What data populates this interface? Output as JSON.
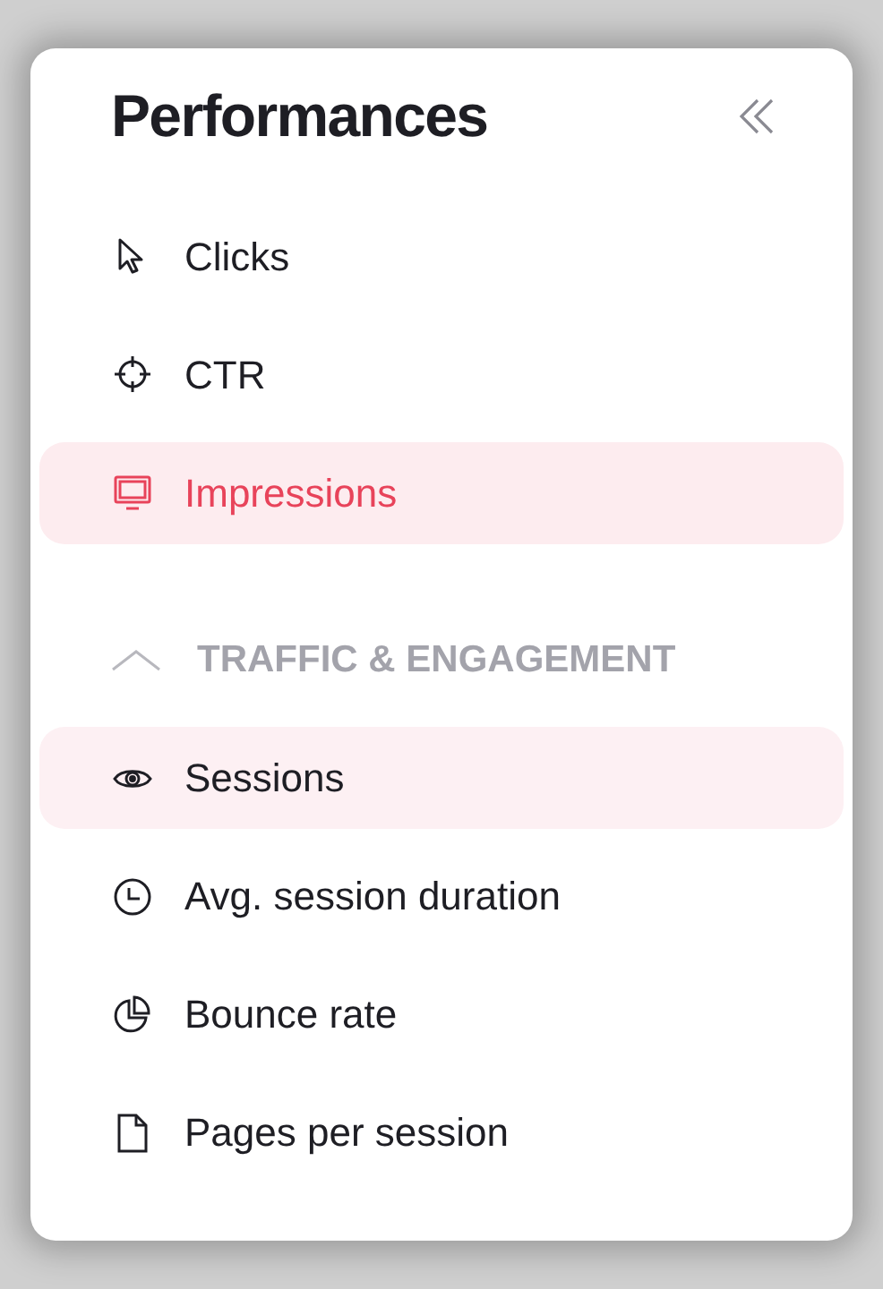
{
  "title": "Performances",
  "items": [
    {
      "label": "Clicks",
      "selected": false,
      "hovered": false
    },
    {
      "label": "CTR",
      "selected": false,
      "hovered": false
    },
    {
      "label": "Impressions",
      "selected": true,
      "hovered": false
    }
  ],
  "section": {
    "label": "TRAFFIC & ENGAGEMENT",
    "expanded": true,
    "items": [
      {
        "label": "Sessions",
        "selected": false,
        "hovered": true
      },
      {
        "label": "Avg. session duration",
        "selected": false,
        "hovered": false
      },
      {
        "label": "Bounce rate",
        "selected": false,
        "hovered": false
      },
      {
        "label": "Pages per session",
        "selected": false,
        "hovered": false
      }
    ]
  }
}
